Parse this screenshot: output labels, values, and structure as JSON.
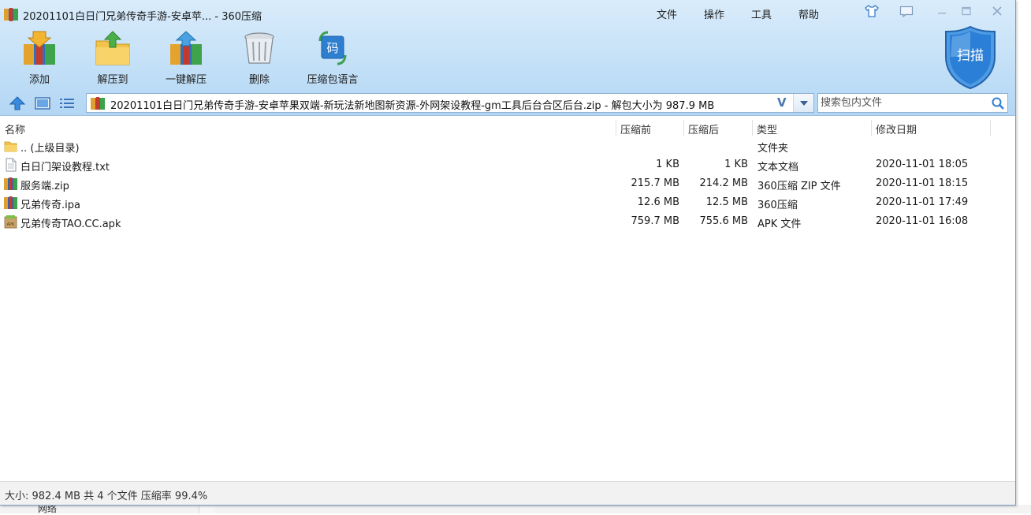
{
  "window": {
    "title": "20201101白日门兄弟传奇手游-安卓苹... - 360压缩"
  },
  "menu": {
    "file": "文件",
    "operate": "操作",
    "tools": "工具",
    "help": "帮助"
  },
  "toolbar": {
    "add": "添加",
    "extract_to": "解压到",
    "one_click_extract": "一键解压",
    "delete": "删除",
    "archive_language": "压缩包语言",
    "scan": "扫描"
  },
  "address": {
    "path": "20201101白日门兄弟传奇手游-安卓苹果双端-新玩法新地图新资源-外网架设教程-gm工具后台合区后台.zip - 解包大小为 987.9 MB",
    "v_mark": "V"
  },
  "search": {
    "placeholder": "搜索包内文件"
  },
  "columns": {
    "name": "名称",
    "before": "压缩前",
    "after": "压缩后",
    "type": "类型",
    "modified": "修改日期"
  },
  "files": [
    {
      "name": ".. (上级目录)",
      "before": "",
      "after": "",
      "type": "文件夹",
      "modified": "",
      "icon": "folder-icon"
    },
    {
      "name": "白日门架设教程.txt",
      "before": "1 KB",
      "after": "1 KB",
      "type": "文本文档",
      "modified": "2020-11-01 18:05",
      "icon": "text-file-icon"
    },
    {
      "name": "服务端.zip",
      "before": "215.7 MB",
      "after": "214.2 MB",
      "type": "360压缩 ZIP 文件",
      "modified": "2020-11-01 18:15",
      "icon": "archive-icon"
    },
    {
      "name": "兄弟传奇.ipa",
      "before": "12.6 MB",
      "after": "12.5 MB",
      "type": "360压缩",
      "modified": "2020-11-01 17:49",
      "icon": "archive-icon"
    },
    {
      "name": "兄弟传奇TAO.CC.apk",
      "before": "759.7 MB",
      "after": "755.6 MB",
      "type": "APK 文件",
      "modified": "2020-11-01 16:08",
      "icon": "apk-icon"
    }
  ],
  "status": {
    "text": "大小: 982.4 MB 共 4 个文件 压缩率 99.4%"
  },
  "desktop": {
    "network_label": "网络"
  },
  "colors": {
    "chrome_top": "#d9ecfb",
    "chrome_bottom": "#b3d6f4",
    "accent": "#2f7fd0"
  }
}
